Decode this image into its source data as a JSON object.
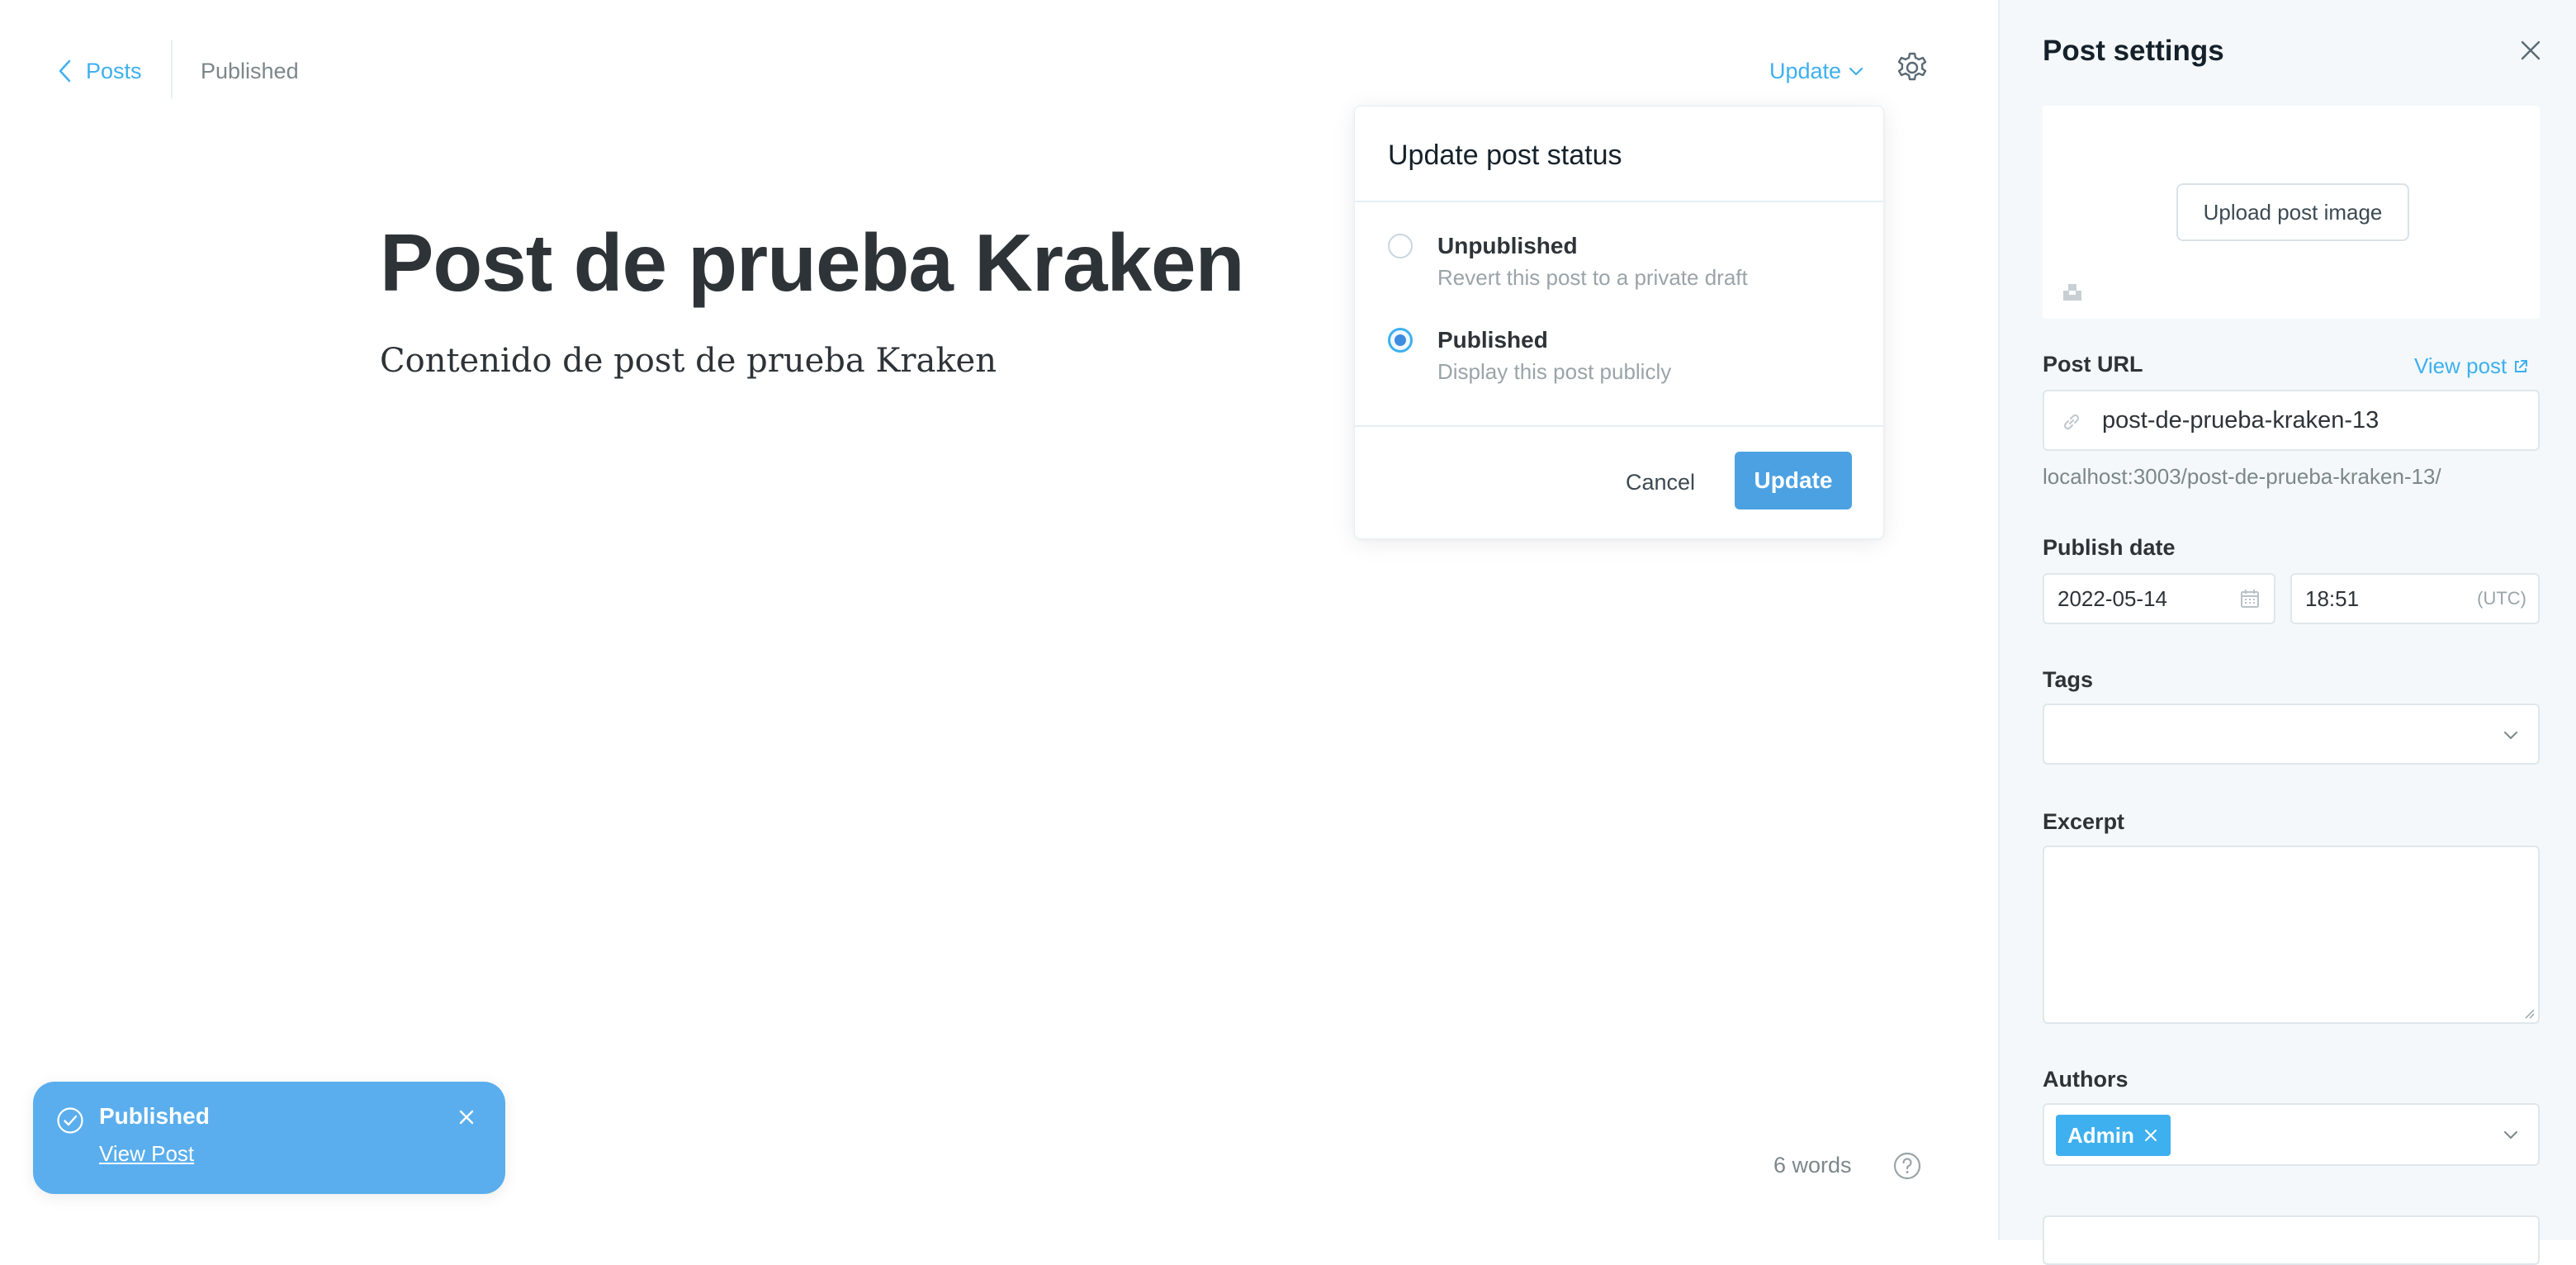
{
  "header": {
    "back_label": "Posts",
    "status": "Published",
    "update_menu_label": "Update"
  },
  "editor": {
    "title": "Post de prueba Kraken",
    "body": "Contenido de post de prueba Kraken",
    "word_count": "6 words"
  },
  "popover": {
    "title": "Update post status",
    "options": [
      {
        "label": "Unpublished",
        "description": "Revert this post to a private draft",
        "selected": false
      },
      {
        "label": "Published",
        "description": "Display this post publicly",
        "selected": true
      }
    ],
    "cancel_label": "Cancel",
    "update_label": "Update"
  },
  "toast": {
    "title": "Published",
    "link": "View Post"
  },
  "settings": {
    "title": "Post settings",
    "upload_label": "Upload post image",
    "post_url_label": "Post URL",
    "view_post_label": "View post",
    "post_url_value": "post-de-prueba-kraken-13",
    "post_url_hint": "localhost:3003/post-de-prueba-kraken-13/",
    "publish_date_label": "Publish date",
    "date_value": "2022-05-14",
    "time_value": "18:51",
    "timezone": "(UTC)",
    "tags_label": "Tags",
    "excerpt_label": "Excerpt",
    "authors_label": "Authors",
    "author_chip": "Admin"
  },
  "colors": {
    "accent": "#3eb0ef",
    "primary_button": "#4ba1e2",
    "toast_bg": "#5aaeed",
    "panel_bg": "#f4f8fb"
  }
}
